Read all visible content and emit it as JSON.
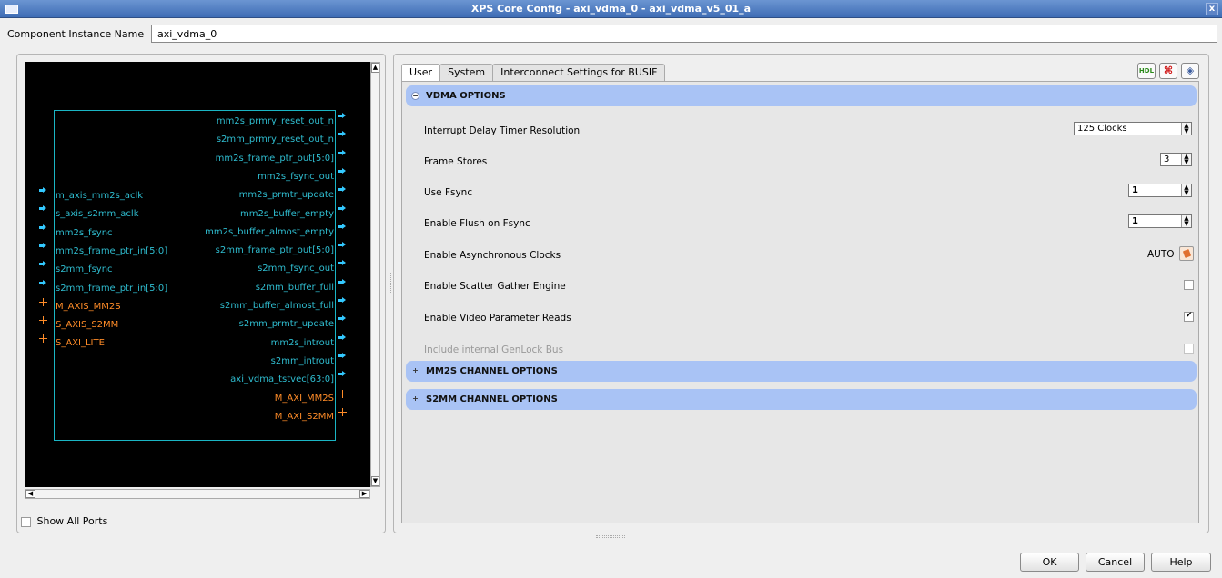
{
  "window": {
    "title": "XPS Core Config - axi_vdma_0 - axi_vdma_v5_01_a",
    "close_label": "x"
  },
  "instance": {
    "label": "Component Instance Name",
    "value": "axi_vdma_0"
  },
  "diagram": {
    "left_ports": [
      {
        "name": "m_axis_mm2s_aclk",
        "type": "signal"
      },
      {
        "name": "s_axis_s2mm_aclk",
        "type": "signal"
      },
      {
        "name": "mm2s_fsync",
        "type": "signal"
      },
      {
        "name": "mm2s_frame_ptr_in[5:0]",
        "type": "signal"
      },
      {
        "name": "s2mm_fsync",
        "type": "signal"
      },
      {
        "name": "s2mm_frame_ptr_in[5:0]",
        "type": "signal"
      },
      {
        "name": "M_AXIS_MM2S",
        "type": "bus"
      },
      {
        "name": "S_AXIS_S2MM",
        "type": "bus"
      },
      {
        "name": "S_AXI_LITE",
        "type": "bus"
      }
    ],
    "right_ports": [
      {
        "name": "mm2s_prmry_reset_out_n",
        "type": "signal"
      },
      {
        "name": "s2mm_prmry_reset_out_n",
        "type": "signal"
      },
      {
        "name": "mm2s_frame_ptr_out[5:0]",
        "type": "signal"
      },
      {
        "name": "mm2s_fsync_out",
        "type": "signal"
      },
      {
        "name": "mm2s_prmtr_update",
        "type": "signal"
      },
      {
        "name": "mm2s_buffer_empty",
        "type": "signal"
      },
      {
        "name": "mm2s_buffer_almost_empty",
        "type": "signal"
      },
      {
        "name": "s2mm_frame_ptr_out[5:0]",
        "type": "signal"
      },
      {
        "name": "s2mm_fsync_out",
        "type": "signal"
      },
      {
        "name": "s2mm_buffer_full",
        "type": "signal"
      },
      {
        "name": "s2mm_buffer_almost_full",
        "type": "signal"
      },
      {
        "name": "s2mm_prmtr_update",
        "type": "signal"
      },
      {
        "name": "mm2s_introut",
        "type": "signal"
      },
      {
        "name": "s2mm_introut",
        "type": "signal"
      },
      {
        "name": "axi_vdma_tstvec[63:0]",
        "type": "signal"
      },
      {
        "name": "M_AXI_MM2S",
        "type": "bus"
      },
      {
        "name": "M_AXI_S2MM",
        "type": "bus"
      }
    ],
    "show_all_ports_label": "Show All Ports",
    "show_all_ports_checked": false,
    "colors": {
      "signal": "#2fbdd0",
      "bus": "#ff8c28",
      "block_border": "#1ab5c4",
      "background": "#000000"
    }
  },
  "tabs": [
    {
      "label": "User",
      "active": true
    },
    {
      "label": "System",
      "active": false
    },
    {
      "label": "Interconnect Settings for BUSIF",
      "active": false
    }
  ],
  "toolbar": {
    "hdl_label": "HDL",
    "icons": [
      "hdl-icon",
      "pdf-datasheet-icon",
      "package-icon"
    ]
  },
  "sections": {
    "vdma": {
      "label": "VDMA OPTIONS",
      "expanded": true
    },
    "mm2s": {
      "label": "MM2S CHANNEL OPTIONS",
      "expanded": false
    },
    "s2mm": {
      "label": "S2MM CHANNEL OPTIONS",
      "expanded": false
    }
  },
  "params": {
    "interrupt_delay": {
      "label": "Interrupt Delay Timer Resolution",
      "value": "125 Clocks"
    },
    "frame_stores": {
      "label": "Frame Stores",
      "value": "3"
    },
    "use_fsync": {
      "label": "Use Fsync",
      "value": "1"
    },
    "enable_flush": {
      "label": "Enable Flush on Fsync",
      "value": "1"
    },
    "async_clocks": {
      "label": "Enable Asynchronous Clocks",
      "value": "AUTO"
    },
    "scatter_gather": {
      "label": "Enable Scatter Gather Engine",
      "checked": false
    },
    "video_param_reads": {
      "label": "Enable Video Parameter Reads",
      "checked": true
    },
    "genlock_bus": {
      "label": "Include internal GenLock Bus",
      "checked": false,
      "enabled": false
    }
  },
  "buttons": {
    "ok": "OK",
    "cancel": "Cancel",
    "help": "Help"
  },
  "accent": "#a9c3f5"
}
